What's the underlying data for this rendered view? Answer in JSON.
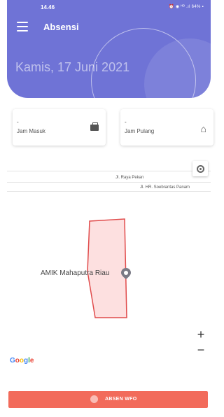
{
  "status_bar": {
    "time": "14.46",
    "icons_text": "⏰ ◉ ᴴᴰ .ıl 64% ▪"
  },
  "app_bar": {
    "title": "Absensi"
  },
  "date": "Kamis, 17 Juni 2021",
  "cards": {
    "in": {
      "value": "-",
      "label": "Jam Masuk",
      "icon": "briefcase-icon"
    },
    "out": {
      "value": "-",
      "label": "Jam Pulang",
      "icon": "home-icon"
    }
  },
  "map": {
    "streets": [
      "Jl. Raya Pekan",
      "Jl. HR. Soebrantas Panam"
    ],
    "place_label": "AMIK Mahaputra Riau",
    "zoom_in": "+",
    "zoom_out": "−",
    "attribution": "Google"
  },
  "action_button": {
    "label": "ABSEN WFO"
  },
  "colors": {
    "header": "#6f73d6",
    "action": "#f26b5b",
    "polygon_fill": "#fde0e0",
    "polygon_stroke": "#e04b4b"
  }
}
